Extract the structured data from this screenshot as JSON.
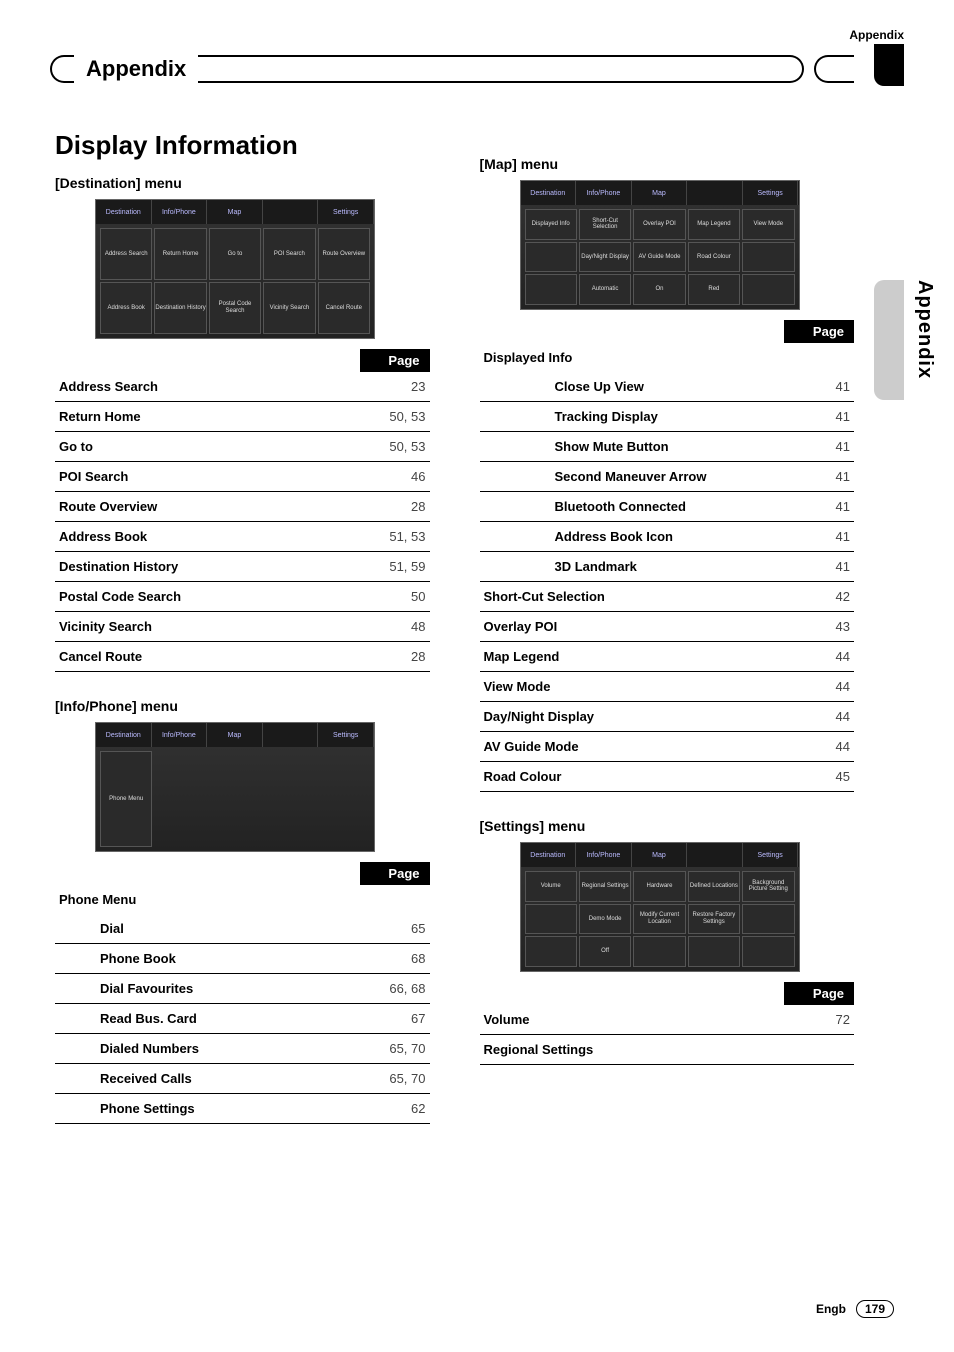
{
  "header": {
    "section": "Appendix"
  },
  "chapter": "Appendix",
  "side_label": "Appendix",
  "title": "Display Information",
  "footer": {
    "lang": "Engb",
    "page": "179"
  },
  "col1": {
    "destination": {
      "heading_prefix": "[Destination]",
      "heading_suffix": " menu",
      "shot_tabs": [
        "Destination",
        "Info/Phone",
        "Map",
        "",
        "Settings"
      ],
      "shot_cells": [
        "Address Search",
        "Return Home",
        "Go to",
        "POI Search",
        "Route Overview",
        "Address Book",
        "Destination History",
        "Postal Code Search",
        "Vicinity Search",
        "Cancel Route"
      ],
      "page_label": "Page",
      "rows": [
        {
          "label": "Address Search",
          "page": "23"
        },
        {
          "label": "Return Home",
          "page": "50, 53"
        },
        {
          "label": "Go to",
          "page": "50, 53"
        },
        {
          "label": "POI Search",
          "page": "46"
        },
        {
          "label": "Route Overview",
          "page": "28"
        },
        {
          "label": "Address Book",
          "page": "51, 53"
        },
        {
          "label": "Destination History",
          "page": "51, 59"
        },
        {
          "label": "Postal Code Search",
          "page": "50"
        },
        {
          "label": "Vicinity Search",
          "page": "48"
        },
        {
          "label": "Cancel Route",
          "page": "28"
        }
      ]
    },
    "infophone": {
      "heading_prefix": "[Info/Phone]",
      "heading_suffix": " menu",
      "shot_tabs": [
        "Destination",
        "Info/Phone",
        "Map",
        "",
        "Settings"
      ],
      "shot_cells_row1": [
        "Phone Menu"
      ],
      "page_label": "Page",
      "group": "Phone Menu",
      "rows": [
        {
          "label": "Dial",
          "page": "65"
        },
        {
          "label": "Phone Book",
          "page": "68"
        },
        {
          "label": "Dial Favourites",
          "page": "66, 68"
        },
        {
          "label": "Read Bus. Card",
          "page": "67"
        },
        {
          "label": "Dialed Numbers",
          "page": "65, 70"
        },
        {
          "label": "Received Calls",
          "page": "65, 70"
        },
        {
          "label": "Phone Settings",
          "page": "62"
        }
      ]
    }
  },
  "col2": {
    "map": {
      "heading_prefix": "[Map]",
      "heading_suffix": " menu",
      "shot_tabs": [
        "Destination",
        "Info/Phone",
        "Map",
        "",
        "Settings"
      ],
      "shot_cells": [
        "Displayed Info",
        "Short-Cut Selection",
        "Overlay POI",
        "Map Legend",
        "View Mode",
        "",
        "Day/Night Display",
        "AV Guide Mode",
        "Road Colour",
        "",
        "",
        "Automatic",
        "On",
        "Red",
        ""
      ],
      "page_label": "Page",
      "group": "Displayed Info",
      "subrows": [
        {
          "label": "Close Up View",
          "page": "41"
        },
        {
          "label": "Tracking Display",
          "page": "41"
        },
        {
          "label": "Show Mute Button",
          "page": "41"
        },
        {
          "label": "Second Maneuver Arrow",
          "page": "41"
        },
        {
          "label": "Bluetooth Connected",
          "page": "41"
        },
        {
          "label": "Address Book Icon",
          "page": "41"
        },
        {
          "label": "3D Landmark",
          "page": "41"
        }
      ],
      "rows": [
        {
          "label": "Short-Cut Selection",
          "page": "42"
        },
        {
          "label": "Overlay POI",
          "page": "43"
        },
        {
          "label": "Map Legend",
          "page": "44"
        },
        {
          "label": "View Mode",
          "page": "44"
        },
        {
          "label": "Day/Night Display",
          "page": "44"
        },
        {
          "label": "AV Guide Mode",
          "page": "44"
        },
        {
          "label": "Road Colour",
          "page": "45"
        }
      ]
    },
    "settings": {
      "heading_prefix": "[Settings]",
      "heading_suffix": " menu",
      "shot_tabs": [
        "Destination",
        "Info/Phone",
        "Map",
        "",
        "Settings"
      ],
      "shot_cells": [
        "Volume",
        "Regional Settings",
        "Hardware",
        "Defined Locations",
        "Background Picture Setting",
        "",
        "Demo Mode",
        "Modify Current Location",
        "Restore Factory Settings",
        "",
        "",
        "Off",
        "",
        "",
        ""
      ],
      "page_label": "Page",
      "rows": [
        {
          "label": "Volume",
          "page": "72"
        },
        {
          "label": "Regional Settings",
          "page": ""
        }
      ]
    }
  }
}
